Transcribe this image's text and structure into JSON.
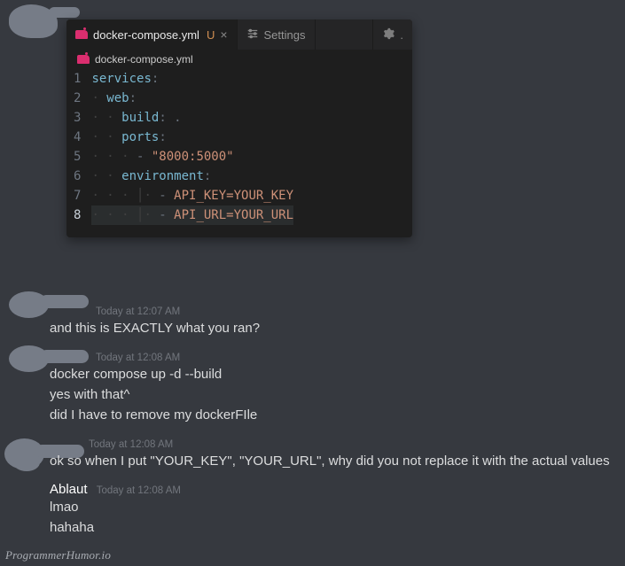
{
  "editor": {
    "tabs": {
      "active": {
        "filename": "docker-compose.yml",
        "modified_marker": "U"
      },
      "settings": {
        "label": "Settings"
      }
    },
    "breadcrumb": "docker-compose.yml",
    "lines": [
      {
        "num": "1",
        "indent": "",
        "key": "services",
        "after": ":"
      },
      {
        "num": "2",
        "indent": "· ",
        "key": "web",
        "after": ":"
      },
      {
        "num": "3",
        "indent": "· · ",
        "key": "build",
        "after": ": ."
      },
      {
        "num": "4",
        "indent": "· · ",
        "key": "ports",
        "after": ":"
      },
      {
        "num": "5",
        "indent": "· · · ",
        "dash": "- ",
        "str": "\"8000:5000\""
      },
      {
        "num": "6",
        "indent": "· · ",
        "key": "environment",
        "after": ":"
      },
      {
        "num": "7",
        "indent": "· · · │· ",
        "dash": "- ",
        "str": "API_KEY=YOUR_KEY"
      },
      {
        "num": "8",
        "indent": "· · · │· ",
        "dash": "- ",
        "str": "API_URL=YOUR_URL",
        "active": true
      }
    ]
  },
  "chat": {
    "m1": {
      "ts": "Today at 12:07 AM",
      "text": "and this is EXACTLY what you ran?"
    },
    "m2": {
      "ts": "Today at 12:08 AM",
      "l1": "docker compose up -d --build",
      "l2": "yes with that^",
      "l3": "did I have to remove my dockerFIle"
    },
    "m3": {
      "ts": "Today at 12:08 AM",
      "text": "ok so when I put \"YOUR_KEY\", \"YOUR_URL\", why did you not replace it with the actual values"
    },
    "m4": {
      "author": "Ablaut",
      "ts": "Today at 12:08 AM",
      "l1": "lmao",
      "l2": "hahaha"
    }
  },
  "watermark": "ProgrammerHumor.io"
}
